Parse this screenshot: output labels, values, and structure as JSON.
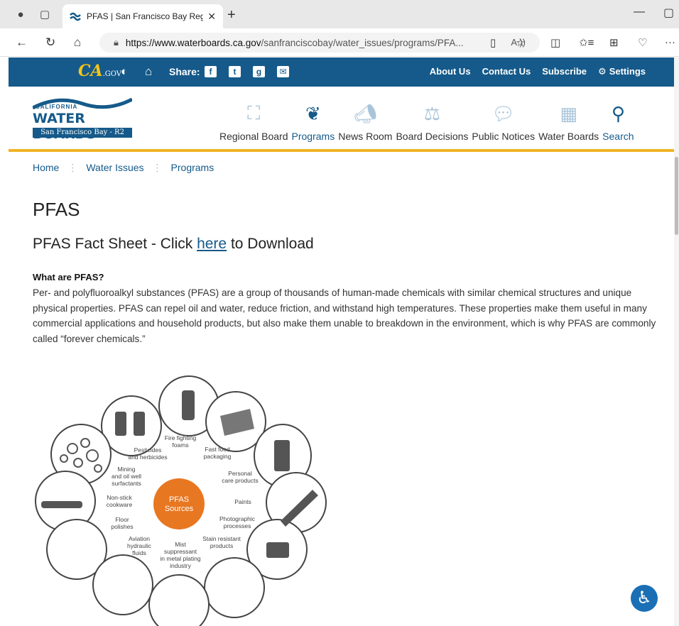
{
  "browser": {
    "tab_title": "PFAS | San Francisco Bay Regiona",
    "url_host": "https://www.waterboards.ca.gov",
    "url_path": "/sanfranciscobay/water_issues/programs/PFA...",
    "read_aloud": "A"
  },
  "site": {
    "cagov": "CA",
    "cagov_small": ".GOV",
    "share_label": "Share:",
    "top_links": [
      "About Us",
      "Contact Us",
      "Subscribe",
      "Settings"
    ],
    "logo_top": "CALIFORNIA",
    "logo_main": "WATER BOARDS",
    "logo_sub": "San Francisco Bay - R2",
    "nav": [
      {
        "label": "Regional Board",
        "icon": "building-network-icon"
      },
      {
        "label": "Programs",
        "icon": "leaf-icon"
      },
      {
        "label": "News Room",
        "icon": "megaphone-icon"
      },
      {
        "label": "Board Decisions",
        "icon": "scales-icon"
      },
      {
        "label": "Public Notices",
        "icon": "speech-bubble-icon"
      },
      {
        "label": "Water Boards",
        "icon": "city-buildings-icon"
      },
      {
        "label": "Search",
        "icon": "search-icon"
      }
    ],
    "accent": "#155a8a",
    "gold": "#f0b323"
  },
  "breadcrumb": [
    "Home",
    "Water Issues",
    "Programs"
  ],
  "page": {
    "title": "PFAS",
    "fact_sheet_pre": "PFAS Fact Sheet - Click ",
    "fact_sheet_link": "here",
    "fact_sheet_post": " to Download",
    "question": "What are PFAS?",
    "paragraph": "Per- and polyfluoroalkyl substances (PFAS) are a group of thousands of human-made chemicals with similar chemical structures and unique physical properties. PFAS can repel oil and water, reduce friction, and withstand high temperatures. These properties make them useful in many commercial applications and household products, but also make them unable to breakdown in the environment, which is why PFAS are commonly called “forever chemicals.”"
  },
  "infographic": {
    "center": [
      "PFAS",
      "Sources"
    ],
    "labels": [
      "Fire fighting",
      "foams",
      "Pesticides",
      "and herbicides",
      "Fast food",
      "packaging",
      "Mining",
      "and oil well",
      "surfactants",
      "Personal",
      "care products",
      "Non-stick",
      "cookware",
      "Paints",
      "Floor",
      "polishes",
      "Photographic",
      "processes",
      "Aviation",
      "hydraulic",
      "fluids",
      "Stain resistant",
      "products",
      "Mist",
      "suppressant",
      "in metal plating",
      "industry"
    ],
    "center_color": "#e87722"
  }
}
